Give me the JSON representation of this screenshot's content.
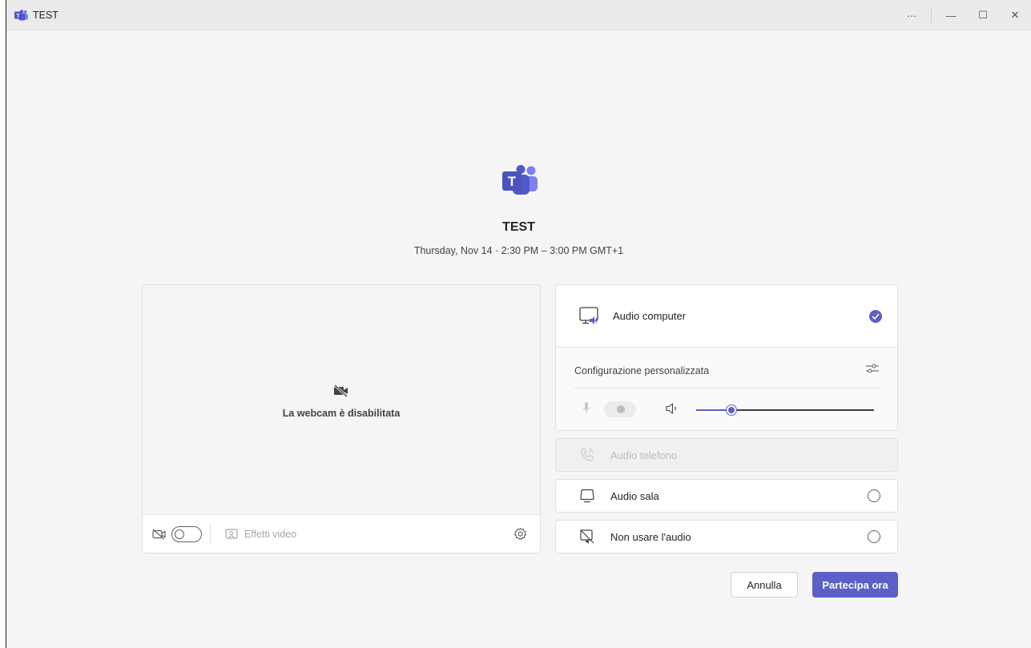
{
  "window": {
    "title": "TEST",
    "controls": {
      "more": "···",
      "minimize": "—",
      "maximize": "☐",
      "close": "✕"
    }
  },
  "meeting": {
    "title": "TEST",
    "datetime": "Thursday, Nov 14 · 2:30 PM – 3:00 PM GMT+1"
  },
  "video": {
    "status_text": "La webcam è disabilitata",
    "camera_on": false,
    "effects_label": "Effetti video"
  },
  "audio": {
    "computer_label": "Audio computer",
    "computer_selected": true,
    "config_label": "Configurazione personalizzata",
    "mic_on": false,
    "speaker_volume": 0.2,
    "options": [
      {
        "label": "Audio telefono",
        "icon": "phone-icon",
        "enabled": false
      },
      {
        "label": "Audio sala",
        "icon": "room-audio-icon",
        "enabled": true,
        "selected": false
      },
      {
        "label": "Non usare l'audio",
        "icon": "no-audio-icon",
        "enabled": true,
        "selected": false
      }
    ]
  },
  "buttons": {
    "cancel": "Annulla",
    "join": "Partecipa ora"
  },
  "colors": {
    "accent": "#5b5fc7",
    "background": "#f5f5f5"
  }
}
